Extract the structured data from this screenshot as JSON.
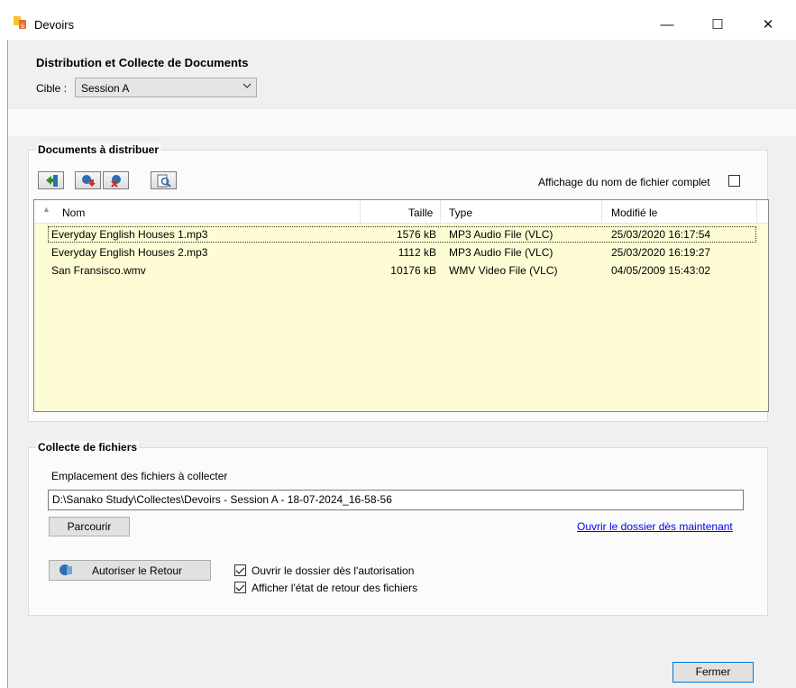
{
  "window": {
    "title": "Devoirs",
    "controls": {
      "minimize": "—",
      "maximize": "☐",
      "close": "✕"
    }
  },
  "header": {
    "title": "Distribution et Collecte de Documents",
    "cible_label": "Cible :",
    "cible_value": "Session A"
  },
  "distribute": {
    "group_title": "Documents à distribuer",
    "toolbar_icons": [
      "add-file-icon",
      "download-icon",
      "remove-file-icon",
      "preview-icon"
    ],
    "full_name_label": "Affichage du nom de fichier complet",
    "full_name_checked": false,
    "columns": {
      "name": "Nom",
      "size": "Taille",
      "type": "Type",
      "modified": "Modifié le"
    },
    "files": [
      {
        "name": "Everyday English Houses 1.mp3",
        "size": "1576 kB",
        "type": "MP3 Audio File (VLC)",
        "modified": "25/03/2020 16:17:54"
      },
      {
        "name": "Everyday English Houses 2.mp3",
        "size": "1112 kB",
        "type": "MP3 Audio File (VLC)",
        "modified": "25/03/2020 16:19:27"
      },
      {
        "name": "San Fransisco.wmv",
        "size": "10176 kB",
        "type": "WMV Video File (VLC)",
        "modified": "04/05/2009 15:43:02"
      }
    ],
    "selected_index": 0
  },
  "collect": {
    "group_title": "Collecte de fichiers",
    "location_label": "Emplacement des fichiers à collecter",
    "location_value": "D:\\Sanako Study\\Collectes\\Devoirs - Session A - 18-07-2024_16-58-56",
    "browse_label": "Parcourir",
    "open_now_link": "Ouvrir le dossier dès maintenant",
    "authorize_label": "Autoriser le Retour",
    "open_on_auth_label": "Ouvrir le dossier dès l'autorisation",
    "open_on_auth_checked": true,
    "show_status_label": "Afficher l'état de retour des fichiers",
    "show_status_checked": true
  },
  "footer": {
    "close_label": "Fermer"
  },
  "colors": {
    "list_bg": "#fdfcd4",
    "link": "#0000ee",
    "panel_bg": "#f0f0f0"
  }
}
